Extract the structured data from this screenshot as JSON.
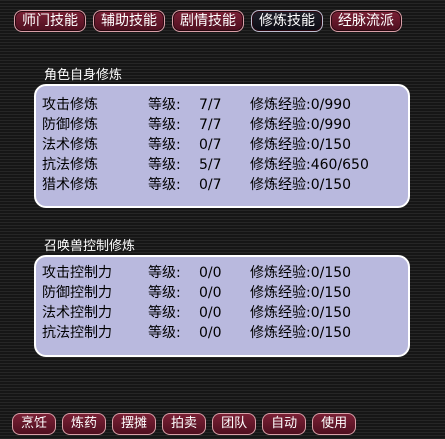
{
  "tabs": [
    {
      "label": "师门技能"
    },
    {
      "label": "辅助技能"
    },
    {
      "label": "剧情技能"
    },
    {
      "label": "修炼技能",
      "active": true
    },
    {
      "label": "经脉流派"
    }
  ],
  "self": {
    "title": "角色自身修炼",
    "rows": [
      {
        "name": "攻击修炼",
        "level_label": "等级:",
        "level": "7/7",
        "exp": "修炼经验:0/990"
      },
      {
        "name": "防御修炼",
        "level_label": "等级:",
        "level": "7/7",
        "exp": "修炼经验:0/990"
      },
      {
        "name": "法术修炼",
        "level_label": "等级:",
        "level": "0/7",
        "exp": "修炼经验:0/150"
      },
      {
        "name": "抗法修炼",
        "level_label": "等级:",
        "level": "5/7",
        "exp": "修炼经验:460/650"
      },
      {
        "name": "猎术修炼",
        "level_label": "等级:",
        "level": "0/7",
        "exp": "修炼经验:0/150"
      }
    ]
  },
  "pet": {
    "title": "召唤兽控制修炼",
    "rows": [
      {
        "name": "攻击控制力",
        "level_label": "等级:",
        "level": "0/0",
        "exp": "修炼经验:0/150"
      },
      {
        "name": "防御控制力",
        "level_label": "等级:",
        "level": "0/0",
        "exp": "修炼经验:0/150"
      },
      {
        "name": "法术控制力",
        "level_label": "等级:",
        "level": "0/0",
        "exp": "修炼经验:0/150"
      },
      {
        "name": "抗法控制力",
        "level_label": "等级:",
        "level": "0/0",
        "exp": "修炼经验:0/150"
      }
    ]
  },
  "bottom_buttons": [
    {
      "label": "烹饪"
    },
    {
      "label": "炼药"
    },
    {
      "label": "摆摊"
    },
    {
      "label": "拍卖"
    },
    {
      "label": "团队"
    },
    {
      "label": "自动"
    },
    {
      "label": "使用"
    }
  ]
}
